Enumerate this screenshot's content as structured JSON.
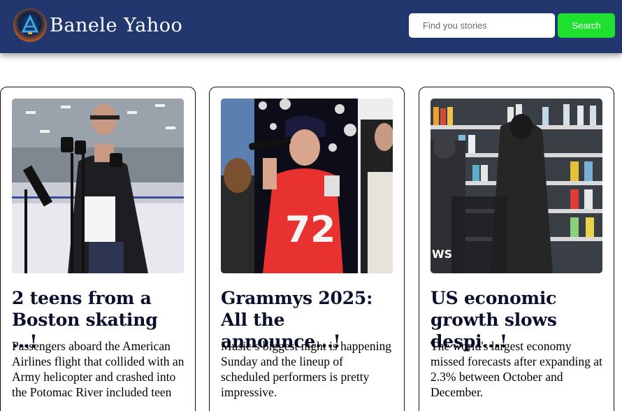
{
  "header": {
    "brand": "Banele Yahoo",
    "logo_icon": "ai-logo-icon",
    "search": {
      "placeholder": "Find you stories",
      "value": "",
      "button_label": "Search"
    },
    "colors": {
      "navbar": "#23376f",
      "search_button": "#1ee02e"
    }
  },
  "cards": [
    {
      "image_subject": "man speaking at microphones in ice rink",
      "title": "2 teens from a Boston skating ...!",
      "description": "Passengers aboard the American Airlines flight that collided with an Army helicopter and crashed into the Potomac River included teen"
    },
    {
      "image_subject": "singer in red 72 jersey with microphone",
      "title": "Grammys 2025: All the announce...!",
      "description": "Music’s biggest night is happening Sunday and the lineup of scheduled performers is pretty impressive."
    },
    {
      "image_subject": "shoppers at supermarket shelves",
      "image_overlay_text": "WS",
      "title": "US economic growth slows despi...!",
      "description": "The world's largest economy missed forecasts after expanding at 2.3% between October and December."
    }
  ]
}
